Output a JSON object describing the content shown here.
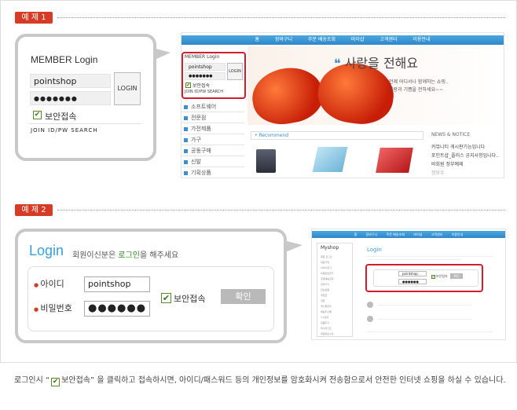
{
  "example1": {
    "badge": "예 제 1",
    "member_login": {
      "title": "MEMBER Login",
      "user_id": "pointshop",
      "password_mask": "●●●●●●●",
      "login_button": "LOGIN",
      "secure_label": "보안접속",
      "links": "JOIN  ID/PW  SEARCH"
    },
    "site": {
      "nav": [
        "홈",
        "장바구니",
        "주문 배송조회",
        "마이샵",
        "고객센터",
        "이용안내"
      ],
      "mini_login_title": "MEMBER Login",
      "mini_user_id": "pointshop",
      "mini_password_mask": "●●●●●●●",
      "mini_login_button": "LOGIN",
      "mini_secure_label": "보안접속",
      "mini_links": "JOIN  ID/PW  SEARCH",
      "hero_quote": "사랑을 전해요",
      "hero_sub1": "언제 어디서나 함께하는 쇼핑..",
      "hero_sub2": "사랑과 기쁨을 전하세요~~",
      "categories": [
        "소프트웨어",
        "전문점",
        "가전제품",
        "가구",
        "공동구매",
        "신발",
        "기획상품"
      ],
      "recommend": "Recommend",
      "news_title": "NEWS & NOTICE",
      "news_items": [
        "커뮤니티 게시판기능입니다",
        "포인트샵_플러스 공지사항입니다..",
        "비회원 정부예제",
        "정보수"
      ]
    }
  },
  "example2": {
    "badge": "예 제 2",
    "login": {
      "title": "Login",
      "subtitle_pre": "회원이신분은 ",
      "subtitle_highlight": "로그인",
      "subtitle_post": "을 해주세요",
      "id_label": "아이디",
      "id_value": "pointshop",
      "pw_label": "비밀번호",
      "pw_mask": "●●●●●●",
      "secure_label": "보안접속",
      "confirm_button": "확인"
    },
    "site": {
      "nav": [
        "홈",
        "장바구니",
        "주문 배송조회",
        "마이샵",
        "고객센터",
        "이용안내"
      ],
      "myshop_title": "Myshop",
      "myshop_items": [
        "회원 로그인",
        "회원가입",
        "아이디찾기",
        "비밀번호찾기",
        "주문배송조회",
        "장바구니",
        "관심상품",
        "적립금",
        "쿠폰",
        "게시물관리",
        "배송주소록",
        "1:1문의",
        "상품후기",
        "위시리스트",
        "회원정보수정"
      ],
      "login_title": "Login",
      "mini_id": "pointshop",
      "mini_pw": "●●●●●●",
      "mini_secure": "보안접속",
      "mini_confirm": "확인"
    }
  },
  "footer": {
    "pre": "로그인시 “",
    "secure_label": "보안접속",
    "post": "” 을  클릭하고 접속하시면, 아이디/패스워드 등의 개인정보를 암호화시켜 전송함으로서 안전한 인터넷 쇼핑을 하실 수 있습니다."
  }
}
